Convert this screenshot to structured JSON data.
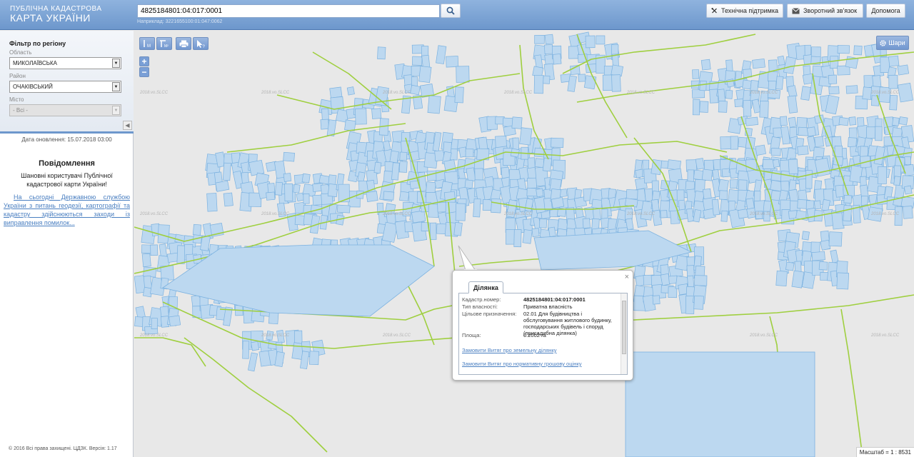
{
  "header": {
    "logo_line1": "ПУБЛІЧНА КАДАСТРОВА",
    "logo_line2": "КАРТА УКРАЇНИ",
    "search_value": "4825184801:04:017:0001",
    "search_hint": "Наприклад: 3221655100:01:047:0062",
    "buttons": {
      "support": "Технічна підтримка",
      "feedback": "Зворотний зв'язок",
      "help": "Допомога"
    }
  },
  "filter": {
    "title": "Фільтр по регіону",
    "region_label": "Область",
    "region_value": "МИКОЛАЇВСЬКА",
    "district_label": "Район",
    "district_value": "ОЧАКІВСЬКИЙ",
    "city_label": "Місто",
    "city_value": "- Всі -"
  },
  "sidebar": {
    "update_date": "Дата оновлення: 15.07.2018 03:00",
    "notice_title": "Повідомлення",
    "notice_greeting": "Шановні користувачі Публічної кадастрової карти України!",
    "notice_link": "На сьогодні Державною службою України з питань геодезії, картографії та кадастру здійснюються заходи із виправлення помилок...",
    "copyright": "© 2016 Всі права захищені. ЦДЗК. Версія: 1.17"
  },
  "map": {
    "layers_label": "Шари",
    "zoom_in": "+",
    "zoom_out": "−",
    "scale": "Масштаб = 1 : 8531",
    "watermark": "2018.vo.SLCC",
    "parcel_fill": "#bcd8f0",
    "parcel_stroke": "#7cb2e0",
    "road_color": "#9fcf3f"
  },
  "popup": {
    "tab": "Ділянка",
    "close": "×",
    "rows": [
      {
        "key": "Кадастр.номер:",
        "value": "4825184801:04:017:0001"
      },
      {
        "key": "Тип власності:",
        "value": "Приватна власність"
      },
      {
        "key": "Цільове призначення:",
        "value": "02.01 Для будівництва і обслуговування житлового будинку, господарських будівель і споруд (присадибна ділянка)"
      },
      {
        "key": "Площа:",
        "value": "0.2002 га"
      }
    ],
    "link1": "Замовити Витяг про земельну ділянку",
    "link2": "Замовити Витяг про нормативну грошову оцінку"
  }
}
